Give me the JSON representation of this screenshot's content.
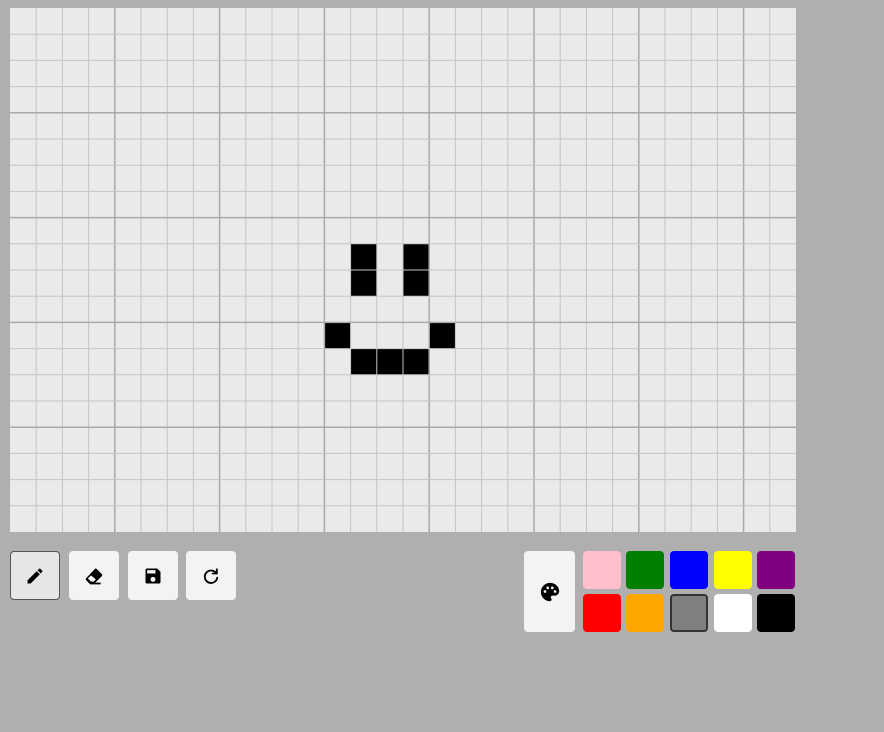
{
  "canvas": {
    "columns": 30,
    "rows": 20,
    "empty_color": "#eaeaea",
    "grid_line_color": "#c4c4c4",
    "major_line_color": "#a9a9a9",
    "major_every": 4,
    "filled_cells": [
      {
        "row": 9,
        "col": 13,
        "color": "#000000"
      },
      {
        "row": 9,
        "col": 15,
        "color": "#000000"
      },
      {
        "row": 10,
        "col": 13,
        "color": "#000000"
      },
      {
        "row": 10,
        "col": 15,
        "color": "#000000"
      },
      {
        "row": 12,
        "col": 12,
        "color": "#000000"
      },
      {
        "row": 12,
        "col": 16,
        "color": "#000000"
      },
      {
        "row": 13,
        "col": 13,
        "color": "#000000"
      },
      {
        "row": 13,
        "col": 14,
        "color": "#000000"
      },
      {
        "row": 13,
        "col": 15,
        "color": "#000000"
      }
    ]
  },
  "toolbar": {
    "tools": [
      {
        "name": "pencil-icon",
        "active": true
      },
      {
        "name": "eraser-icon",
        "active": false
      },
      {
        "name": "save-icon",
        "active": false
      },
      {
        "name": "redo-icon",
        "active": false
      }
    ]
  },
  "palette": {
    "icon": "palette-icon",
    "selected_color": "#808080",
    "colors": [
      [
        "#ffc0cb",
        "#008000",
        "#0000ff",
        "#ffff00",
        "#800080"
      ],
      [
        "#ff0000",
        "#ffa500",
        "#808080",
        "#ffffff",
        "#000000"
      ]
    ]
  }
}
